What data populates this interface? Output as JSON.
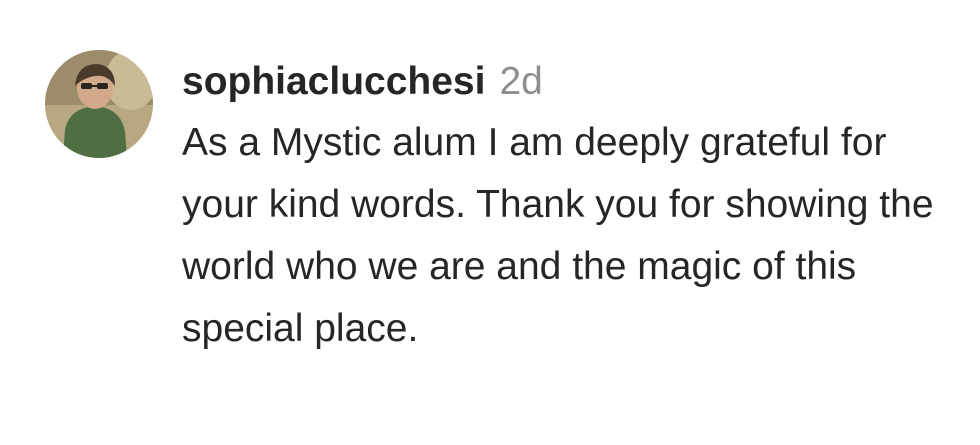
{
  "comment": {
    "username": "sophiaclucchesi",
    "timestamp": "2d",
    "text": "As a Mystic alum I am deeply grateful for your kind words. Thank you for showing the world who we are and the magic of this special place."
  },
  "colors": {
    "username": "#262626",
    "timestamp": "#8e8e8e",
    "text": "#262626",
    "background": "#ffffff"
  },
  "icons": {
    "avatar": "user-avatar"
  }
}
